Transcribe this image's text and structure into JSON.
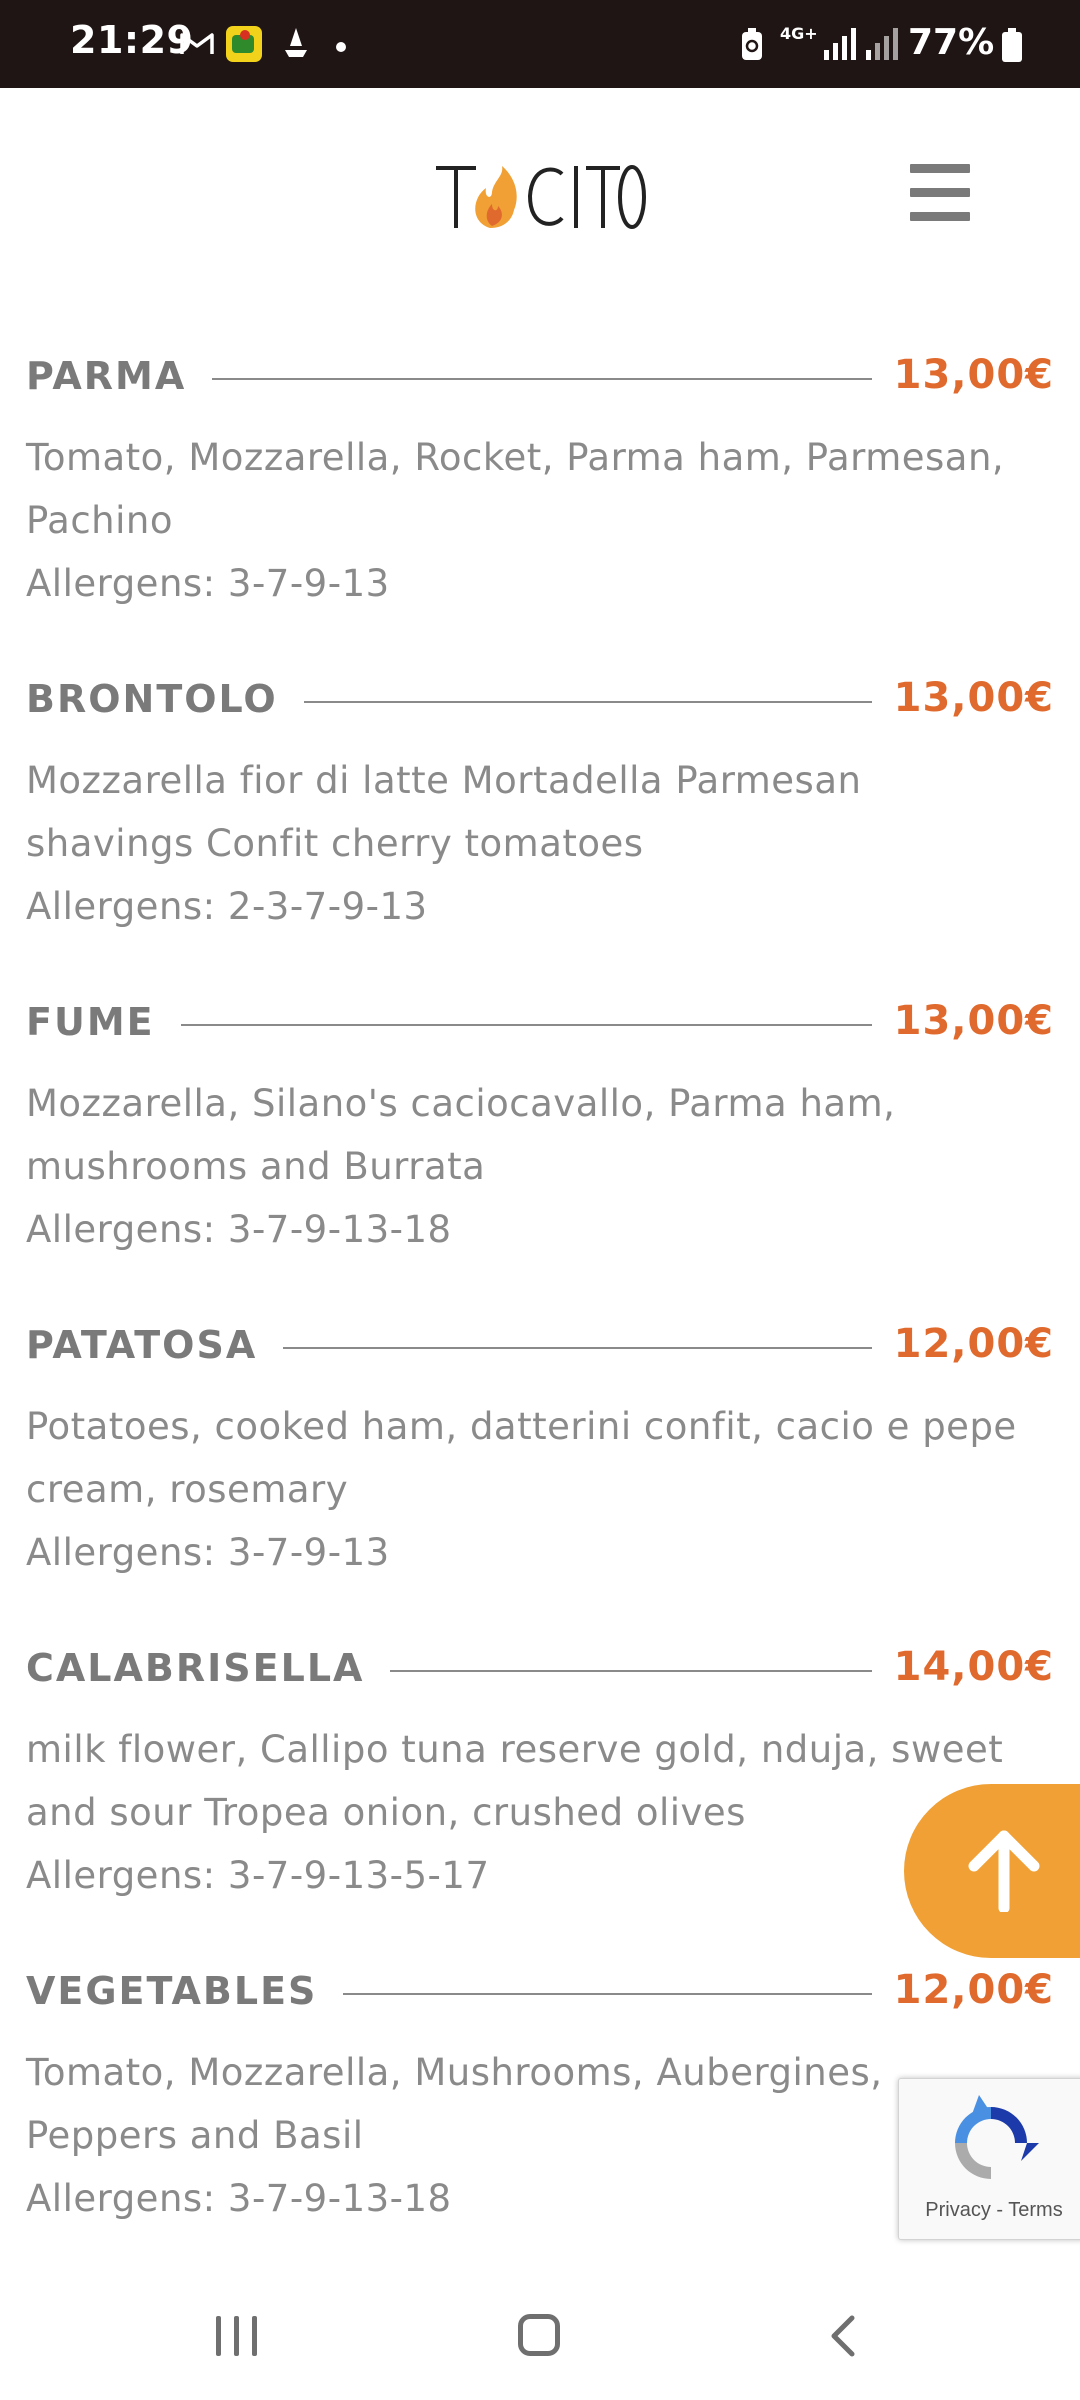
{
  "status_bar": {
    "time": "21:29",
    "network": "4G+",
    "battery": "77%",
    "icons": [
      "gmail-icon",
      "app-notification-icon",
      "boat-icon",
      "dot",
      "battery-saver-icon",
      "signal-icon",
      "signal-icon",
      "battery-icon"
    ]
  },
  "header": {
    "logo_text": "TACITO",
    "logo_accent_color": "#f0a034",
    "menu_icon": "hamburger-menu-icon"
  },
  "menu": {
    "items": [
      {
        "name": "PARMA",
        "price": "13,00€",
        "description": "Tomato, Mozzarella, Rocket, Parma ham, Parmesan, Pachino",
        "allergens": "Allergens: 3-7-9-13"
      },
      {
        "name": "BRONTOLO",
        "price": "13,00€",
        "description": "Mozzarella fior di latte Mortadella Parmesan shavings Confit cherry tomatoes",
        "allergens": "Allergens: 2-3-7-9-13"
      },
      {
        "name": "FUME",
        "price": "13,00€",
        "description": "Mozzarella, Silano's caciocavallo, Parma ham, mushrooms and Burrata",
        "allergens": "Allergens: 3-7-9-13-18"
      },
      {
        "name": "PATATOSA",
        "price": "12,00€",
        "description": "Potatoes, cooked ham, datterini confit, cacio e pepe cream, rosemary",
        "allergens": "Allergens: 3-7-9-13"
      },
      {
        "name": "CALABRISELLA",
        "price": "14,00€",
        "description": "milk flower, Callipo tuna reserve gold, nduja, sweet and sour Tropea onion, crushed olives",
        "allergens": "Allergens: 3-7-9-13-5-17"
      },
      {
        "name": "VEGETABLES",
        "price": "12,00€",
        "description": "Tomato, Mozzarella, Mushrooms, Aubergines, Peppers and Basil",
        "allergens": "Allergens: 3-7-9-13-18"
      }
    ],
    "price_color": "#e06a2d",
    "text_color": "#8a8a8a"
  },
  "recaptcha": {
    "privacy": "Privacy",
    "separator": " - ",
    "terms": "Terms"
  },
  "scroll_top": {
    "icon": "arrow-up-icon",
    "color": "#f0a034"
  },
  "nav_bar": {
    "icons": [
      "recent-apps-icon",
      "home-icon",
      "back-icon"
    ]
  }
}
